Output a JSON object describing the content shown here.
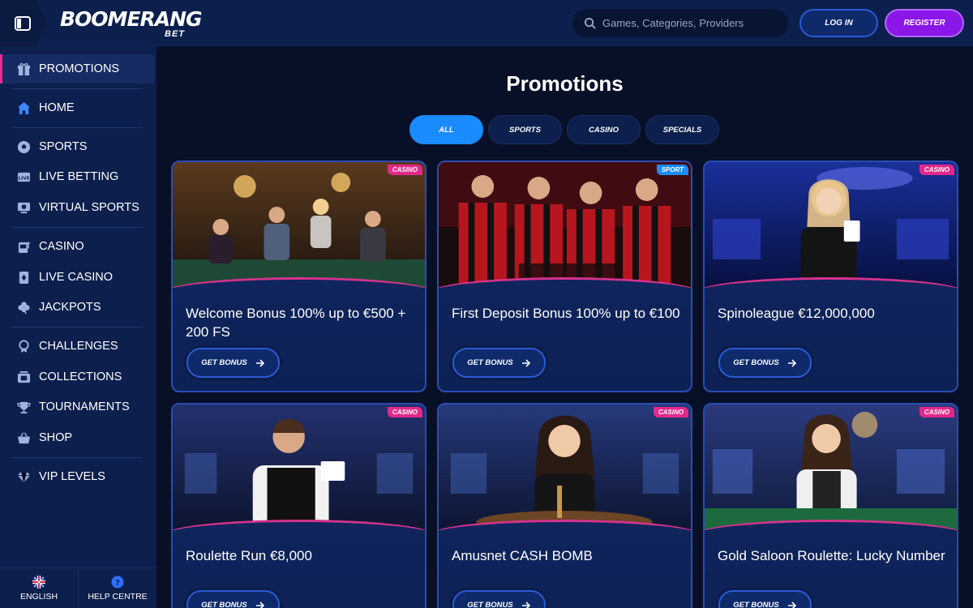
{
  "header": {
    "logo_main": "BOOMERANG",
    "logo_sub": "BET",
    "search_placeholder": "Games, Categories, Providers",
    "login_label": "LOG IN",
    "register_label": "REGISTER"
  },
  "sidebar": {
    "items": [
      {
        "label": "PROMOTIONS",
        "icon": "gift-icon",
        "active": true
      },
      {
        "label": "HOME",
        "icon": "home-icon"
      },
      {
        "label": "SPORTS",
        "icon": "soccer-ball-icon"
      },
      {
        "label": "LIVE BETTING",
        "icon": "live-icon"
      },
      {
        "label": "VIRTUAL SPORTS",
        "icon": "virtual-screen-icon"
      },
      {
        "label": "CASINO",
        "icon": "slot-machine-icon"
      },
      {
        "label": "LIVE CASINO",
        "icon": "live-casino-icon"
      },
      {
        "label": "JACKPOTS",
        "icon": "clover-icon"
      },
      {
        "label": "CHALLENGES",
        "icon": "medal-icon"
      },
      {
        "label": "COLLECTIONS",
        "icon": "collection-icon"
      },
      {
        "label": "TOURNAMENTS",
        "icon": "trophy-icon"
      },
      {
        "label": "SHOP",
        "icon": "basket-icon"
      },
      {
        "label": "VIP LEVELS",
        "icon": "diamond-icon"
      }
    ],
    "language_label": "ENGLISH",
    "help_label": "HELP CENTRE"
  },
  "main": {
    "title": "Promotions",
    "tabs": [
      "ALL",
      "SPORTS",
      "CASINO",
      "SPECIALS"
    ],
    "active_tab": "ALL",
    "cards": [
      {
        "badge": "CASINO",
        "title": "Welcome Bonus 100% up to €500 + 200 FS",
        "button": "GET BONUS"
      },
      {
        "badge": "SPORT",
        "title": "First Deposit Bonus 100% up to €100",
        "button": "GET BONUS"
      },
      {
        "badge": "CASINO",
        "title": "Spinoleague €12,000,000",
        "button": "GET BONUS"
      },
      {
        "badge": "CASINO",
        "title": "Roulette Run €8,000",
        "button": "GET BONUS"
      },
      {
        "badge": "CASINO",
        "title": "Amusnet CASH BOMB",
        "button": "GET BONUS"
      },
      {
        "badge": "CASINO",
        "title": "Gold Saloon Roulette: Lucky Number",
        "button": "GET BONUS"
      }
    ]
  },
  "colors": {
    "background": "#081028",
    "panel": "#0c1f4d",
    "accent_blue": "#1a8cff",
    "accent_pink": "#e3288a",
    "register_purple": "#8a16e8"
  }
}
